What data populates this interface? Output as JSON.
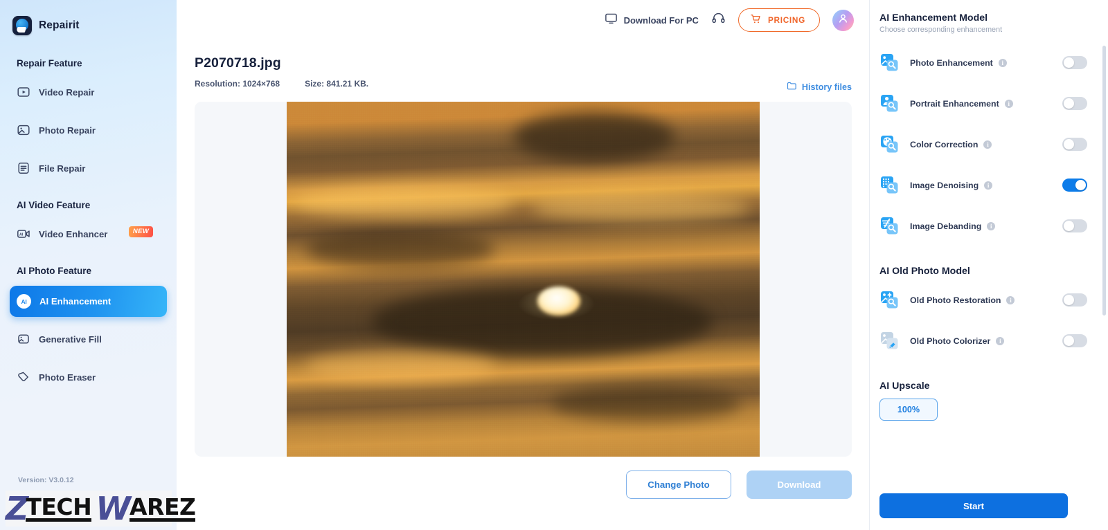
{
  "brand": {
    "name": "Repairit",
    "logo_icon": "repairit-logo-icon"
  },
  "sidebar": {
    "groups": [
      {
        "title": "Repair Feature",
        "items": [
          {
            "label": "Video Repair",
            "icon": "video-play-icon",
            "active": false
          },
          {
            "label": "Photo Repair",
            "icon": "photo-icon",
            "active": false
          },
          {
            "label": "File Repair",
            "icon": "file-doc-icon",
            "active": false
          }
        ]
      },
      {
        "title": "AI Video Feature",
        "items": [
          {
            "label": "Video Enhancer",
            "icon": "ai-video-icon",
            "active": false,
            "badge": "NEW"
          }
        ]
      },
      {
        "title": "AI Photo Feature",
        "items": [
          {
            "label": "AI Enhancement",
            "icon": "ai-chip-icon",
            "active": true
          },
          {
            "label": "Generative Fill",
            "icon": "generative-fill-icon",
            "active": false
          },
          {
            "label": "Photo Eraser",
            "icon": "eraser-icon",
            "active": false
          }
        ]
      }
    ],
    "version": "Version: V3.0.12"
  },
  "watermark": {
    "part1": "Z",
    "part2": "TECH",
    "part3": "W",
    "part4": "AREZ"
  },
  "topbar": {
    "download_for_pc": "Download For PC",
    "download_icon": "monitor-icon",
    "support_icon": "headset-icon",
    "pricing": "PRICING",
    "cart_icon": "cart-icon",
    "avatar_icon": "user-avatar-icon"
  },
  "file": {
    "name": "P2070718.jpg",
    "resolution": "Resolution: 1024×768",
    "size": "Size: 841.21 KB.",
    "history_link": "History files",
    "history_icon": "folder-icon"
  },
  "actions": {
    "change_photo": "Change Photo",
    "download": "Download"
  },
  "panel": {
    "title": "AI Enhancement Model",
    "subtitle": "Choose corresponding enhancement",
    "enhancement_models": [
      {
        "label": "Photo Enhancement",
        "icon": "photo-enhancement-icon",
        "enabled": false
      },
      {
        "label": "Portrait Enhancement",
        "icon": "portrait-enhancement-icon",
        "enabled": false
      },
      {
        "label": "Color Correction",
        "icon": "color-correction-icon",
        "enabled": false
      },
      {
        "label": "Image Denoising",
        "icon": "image-denoising-icon",
        "enabled": true
      },
      {
        "label": "Image Debanding",
        "icon": "image-debanding-icon",
        "enabled": false
      }
    ],
    "old_photo_title": "AI Old Photo Model",
    "old_photo_models": [
      {
        "label": "Old Photo Restoration",
        "icon": "old-photo-restoration-icon",
        "enabled": false
      },
      {
        "label": "Old Photo Colorizer",
        "icon": "old-photo-colorizer-icon",
        "enabled": false
      }
    ],
    "upscale_title": "AI Upscale",
    "upscale_value": "100%",
    "start_label": "Start"
  },
  "colors": {
    "accent_blue": "#0d7ce9",
    "pricing_orange": "#f0652a",
    "toggle_off": "#d7dce4",
    "sidebar_top": "#cfe6fb",
    "text_dark": "#17213c"
  }
}
